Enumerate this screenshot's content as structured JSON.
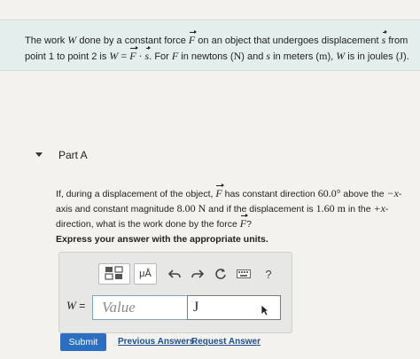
{
  "intro": {
    "t1": "The work ",
    "W": "W",
    "t2": " done by a constant force ",
    "F": "F",
    "t3": " on an object that undergoes displacement ",
    "s": "s",
    "t4": " from point 1 to point 2 is ",
    "W2": "W",
    "eq": " = ",
    "F2": "F",
    "dot": " · ",
    "s2": "s",
    "t5": ". For ",
    "F3": "F",
    "t6": " in newtons (",
    "N": "N",
    "t7": ") and ",
    "s3": "s",
    "t8": " in meters (",
    "m": "m",
    "t9": "), ",
    "W3": "W",
    "t10": " is in joules (",
    "J": "J",
    "t11": ")."
  },
  "part": {
    "title": "Part A"
  },
  "question": {
    "t1": "If, during a displacement of the object, ",
    "F": "F",
    "t2": " has constant direction ",
    "angle": "60.0°",
    "t3": " above the ",
    "xaxis": "−x",
    "t4": "-axis and constant magnitude ",
    "mag": "8.00 N",
    "t5": " and if the displacement is ",
    "disp": "1.60 m",
    "t6": " in the ",
    "xdir": "+x",
    "t7": "-direction, what is the work done by the force ",
    "F2": "F",
    "t8": "?"
  },
  "instruction": "Express your answer with the appropriate units.",
  "toolbar": {
    "templates_icon": "templates-icon",
    "units_label": "μÅ",
    "undo_icon": "undo-icon",
    "redo_icon": "redo-icon",
    "reset_icon": "reset-icon",
    "keyboard_icon": "keyboard-icon",
    "help_label": "?"
  },
  "answer": {
    "variable": "W",
    "equals": "=",
    "value_placeholder": "Value",
    "units_value": "J"
  },
  "actions": {
    "submit": "Submit",
    "previous_answers": "Previous Answers",
    "request_answer": "Request Answer"
  },
  "colors": {
    "intro_bg": "#e4eeec",
    "submit_bg": "#2c6fc2",
    "link": "#1d4f91"
  }
}
